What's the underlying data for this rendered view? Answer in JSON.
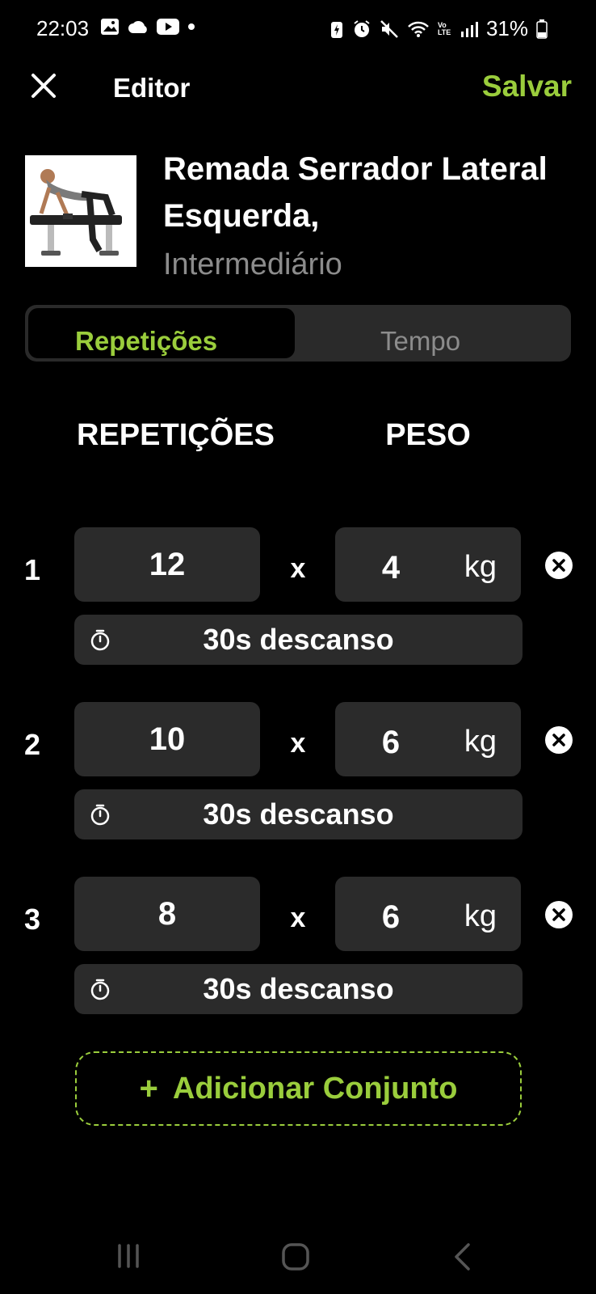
{
  "status_bar": {
    "time": "22:03",
    "battery": "31%",
    "network": "Vo LTE"
  },
  "header": {
    "title": "Editor",
    "save_label": "Salvar"
  },
  "exercise": {
    "name": "Remada Serrador Lateral Esquerda,",
    "level": "Intermediário"
  },
  "tabs": [
    {
      "label": "Repetições",
      "active": true
    },
    {
      "label": "Tempo",
      "active": false
    }
  ],
  "columns": {
    "reps": "REPETIÇÕES",
    "weight": "PESO"
  },
  "sets": [
    {
      "number": "1",
      "reps": "12",
      "weight": "4",
      "unit": "kg",
      "rest": "30s descanso"
    },
    {
      "number": "2",
      "reps": "10",
      "weight": "6",
      "unit": "kg",
      "rest": "30s descanso"
    },
    {
      "number": "3",
      "reps": "8",
      "weight": "6",
      "unit": "kg",
      "rest": "30s descanso"
    }
  ],
  "multiply_symbol": "x",
  "add_set": {
    "plus": "+",
    "label": "Adicionar Conjunto"
  },
  "colors": {
    "accent": "#9acd3c",
    "background": "#000000",
    "field": "#2b2b2b"
  }
}
